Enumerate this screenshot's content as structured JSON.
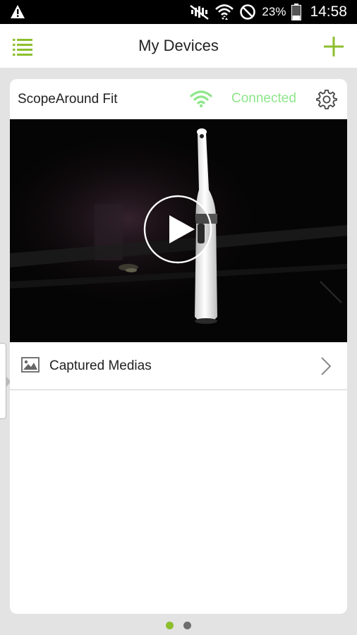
{
  "status_bar": {
    "battery_percent": "23%",
    "time": "14:58",
    "icons": [
      "warning-icon",
      "mute-icon",
      "wifi-icon",
      "do-not-disturb-icon",
      "battery-icon"
    ]
  },
  "app_bar": {
    "title": "My Devices",
    "menu_icon": "menu-icon",
    "add_icon": "add-icon"
  },
  "device": {
    "name": "ScopeAround Fit",
    "connection_status": "Connected",
    "wifi_icon": "wifi-icon",
    "settings_icon": "gear-icon",
    "video_action": "play-icon",
    "media_row": {
      "label": "Captured Medias",
      "icon": "image-icon",
      "chevron": "chevron-right-icon"
    }
  },
  "pagination": {
    "pages": 2,
    "current": 1
  },
  "colors": {
    "accent": "#8dbf2e",
    "connected": "#8ee68a",
    "background": "#e3e3e3",
    "dot_inactive": "#6e6e6e"
  }
}
